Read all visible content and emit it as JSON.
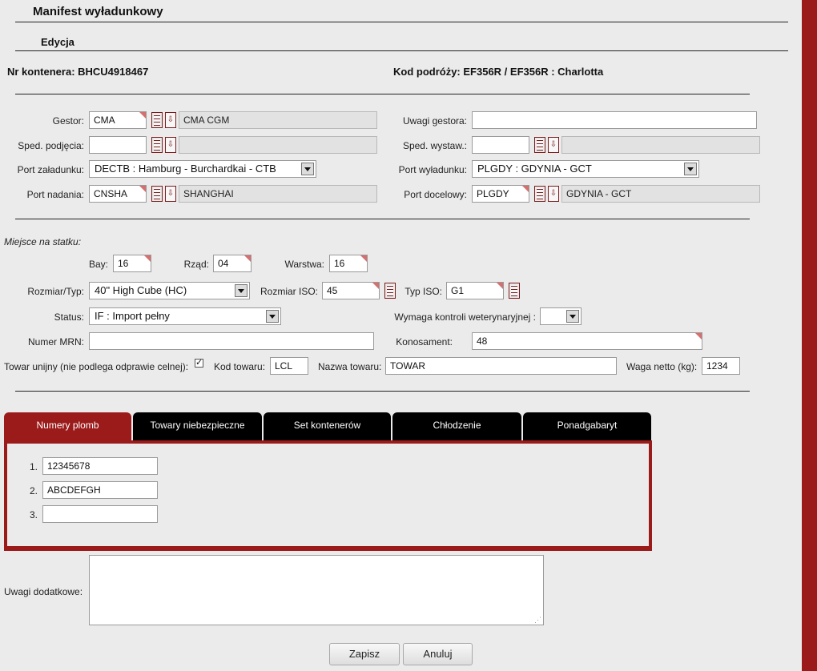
{
  "page": {
    "title": "Manifest wyładunkowy",
    "subtitle": "Edycja"
  },
  "header": {
    "container_label": "Nr kontenera: BHCU4918467",
    "voyage_label": "Kod podróży: EF356R / EF356R : Charlotta"
  },
  "form": {
    "gestor": {
      "label": "Gestor:",
      "code": "CMA",
      "name": "CMA CGM"
    },
    "uwagi_gestora": {
      "label": "Uwagi gestora:",
      "value": ""
    },
    "sped_podjecia": {
      "label": "Sped. podjęcia:",
      "code": "",
      "name": ""
    },
    "sped_wystaw": {
      "label": "Sped. wystaw.:",
      "code": "",
      "name": ""
    },
    "port_zaladunku": {
      "label": "Port załadunku:",
      "value": "DECTB : Hamburg - Burchardkai - CTB"
    },
    "port_wyladunku": {
      "label": "Port wyładunku:",
      "value": "PLGDY : GDYNIA - GCT"
    },
    "port_nadania": {
      "label": "Port nadania:",
      "code": "CNSHA",
      "name": "SHANGHAI"
    },
    "port_docelowy": {
      "label": "Port docelowy:",
      "code": "PLGDY",
      "name": "GDYNIA - GCT"
    }
  },
  "ship_place": {
    "heading": "Miejsce na statku:",
    "bay": {
      "label": "Bay:",
      "value": "16"
    },
    "rzad": {
      "label": "Rząd:",
      "value": "04"
    },
    "warstwa": {
      "label": "Warstwa:",
      "value": "16"
    }
  },
  "container": {
    "rozmiar_typ": {
      "label": "Rozmiar/Typ:",
      "value": "40\" High Cube (HC)"
    },
    "rozmiar_iso": {
      "label": "Rozmiar ISO:",
      "value": "45"
    },
    "typ_iso": {
      "label": "Typ ISO:",
      "value": "G1"
    },
    "status": {
      "label": "Status:",
      "value": "IF : Import pełny"
    },
    "weterynaria": {
      "label": "Wymaga kontroli weterynaryjnej :",
      "value": ""
    },
    "numer_mrn": {
      "label": "Numer MRN:",
      "value": ""
    },
    "konosament": {
      "label": "Konosament:",
      "value": "48"
    },
    "towar_unijny": {
      "label": "Towar unijny (nie podlega odprawie celnej):",
      "checked": true
    },
    "kod_towaru": {
      "label": "Kod towaru:",
      "value": "LCL"
    },
    "nazwa_towaru": {
      "label": "Nazwa towaru:",
      "value": "TOWAR"
    },
    "waga_netto": {
      "label": "Waga netto (kg):",
      "value": "1234"
    }
  },
  "tabs": [
    {
      "label": "Numery plomb",
      "active": true
    },
    {
      "label": "Towary niebezpieczne",
      "active": false
    },
    {
      "label": "Set kontenerów",
      "active": false
    },
    {
      "label": "Chłodzenie",
      "active": false
    },
    {
      "label": "Ponadgabaryt",
      "active": false
    }
  ],
  "seals": [
    {
      "index": "1.",
      "value": "12345678"
    },
    {
      "index": "2.",
      "value": "ABCDEFGH"
    },
    {
      "index": "3.",
      "value": ""
    }
  ],
  "uwagi_dodatkowe": {
    "label": "Uwagi dodatkowe:",
    "value": ""
  },
  "buttons": {
    "save": "Zapisz",
    "cancel": "Anuluj"
  },
  "colors": {
    "accent": "#9b1b1b",
    "tab_inactive": "#000000",
    "page_bg": "#ebebeb"
  },
  "icons": {
    "list": "list-lookup-icon",
    "download": "download-arrow-icon",
    "dropdown": "dropdown-arrow-icon",
    "resize": "resize-grip-icon"
  }
}
